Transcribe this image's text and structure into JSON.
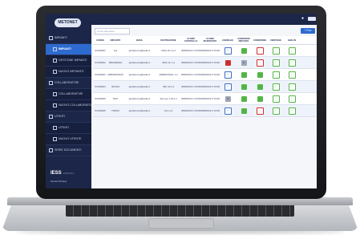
{
  "app": {
    "logo_text": "METONET",
    "search_placeholder": "Cerca dispositivi",
    "new_button": "+ Fun"
  },
  "sidebar": {
    "items": [
      {
        "label": "IMPIANTI",
        "active": false,
        "sub": false
      },
      {
        "label": "IMPIANTI",
        "active": true,
        "sub": true
      },
      {
        "label": "GESTIONE IMPIANTI",
        "active": false,
        "sub": true
      },
      {
        "label": "NUOVO IMPIANTO",
        "active": false,
        "sub": true
      },
      {
        "label": "COLLABORATORI",
        "active": false,
        "sub": false
      },
      {
        "label": "COLLABORATORI",
        "active": false,
        "sub": true
      },
      {
        "label": "NUOVO COLLABORATORE",
        "active": false,
        "sub": true
      },
      {
        "label": "UTENTI",
        "active": false,
        "sub": false
      },
      {
        "label": "UTENTI",
        "active": false,
        "sub": true
      },
      {
        "label": "NUOVO UTENTE",
        "active": false,
        "sub": true
      },
      {
        "label": "SERIE DOCUMENTI",
        "active": false,
        "sub": false
      }
    ],
    "footer_brand": "IESS",
    "footer_version": "V 0.0.0.0.1",
    "footer_links": "Termini   Privacy"
  },
  "table": {
    "headers": [
      "CODICE",
      "IMPIANTO",
      "EMAIL",
      "DESTINAZIONE",
      "ULTIMO CONTROLLO",
      "ULTIMO INTERVENTO",
      "ANOMALIE",
      "CONDIZIONI IMPIANTO",
      "CONDIZIONE",
      "VERIFICHE",
      "ANALISI"
    ],
    "rows": [
      {
        "id": "ID:0000001",
        "ass": "test",
        "mail": "giordano.test@studio.it",
        "dest": "Ufficio 00 1-2-3",
        "d1": "08/05/2019 17:00:00",
        "d2": "08/05/2019 17:00:00",
        "icons": [
          "blue",
          "green",
          "red",
          "chk",
          "chk"
        ]
      },
      {
        "id": "ID:0000002",
        "ass": "PRESIDENZA",
        "mail": "giordano.test@studio.it",
        "dest": "Ufficio 01 -1-2",
        "d1": "08/05/2019 17:00:00",
        "d2": "08/05/2019 17:00:00",
        "icons": [
          "redfill",
          "gray",
          "red",
          "chk",
          "chk"
        ]
      },
      {
        "id": "ID:0000003",
        "ass": "AMMINISTRAZIONE",
        "mail": "giordano.test@studio.it",
        "dest": "AMMINISTRAZ. 1-2",
        "d1": "08/05/2019 17:00:00",
        "d2": "08/05/2019 17:00:00",
        "icons": [
          "blue",
          "green",
          "green",
          "chk",
          "chk"
        ]
      },
      {
        "id": "ID:0000004",
        "ass": "UFFICIO",
        "mail": "giordano.test@studio.it",
        "dest": "Uffic. 00-1-2",
        "d1": "08/05/2019 17:00:00",
        "d2": "08/05/2019 17:00:00",
        "icons": [
          "blue",
          "green",
          "green",
          "chk",
          "chk"
        ]
      },
      {
        "id": "ID:0000005",
        "ass": "TEST",
        "mail": "giordano.test@studio.it",
        "dest": "Test impi. 1-02-1-4",
        "d1": "08/05/2019 17:00:00",
        "d2": "08/05/2019 17:00:00",
        "icons": [
          "gray",
          "green",
          "green",
          "chk",
          "chk"
        ]
      },
      {
        "id": "ID:0000006",
        "ass": "TORINO",
        "mail": "giordano.test@studio.it",
        "dest": "Via 1-2-3",
        "d1": "08/05/2019 17:00:00",
        "d2": "08/05/2019 17:00:00",
        "icons": [
          "blue",
          "green",
          "red",
          "chk",
          "chk"
        ]
      }
    ]
  }
}
